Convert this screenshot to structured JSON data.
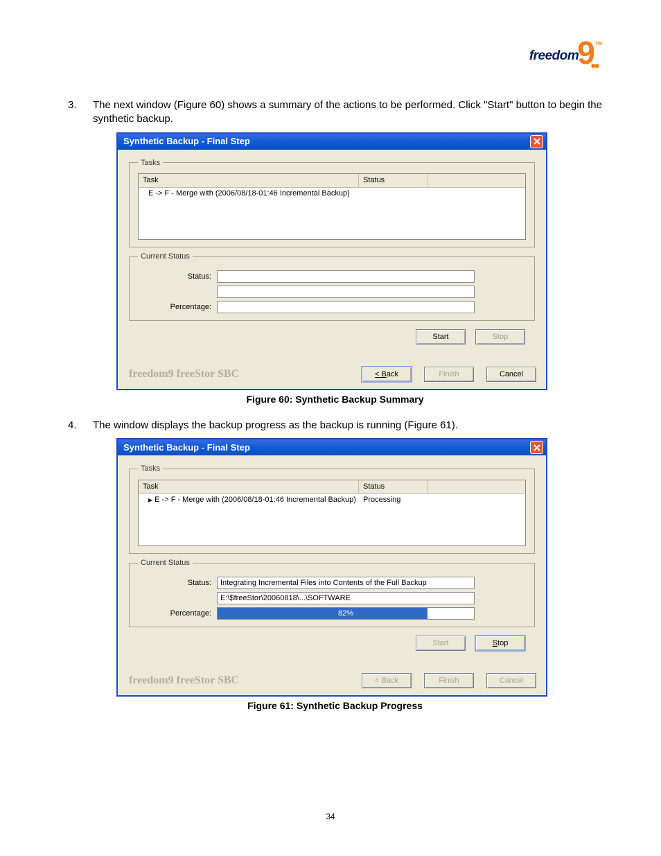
{
  "logo": {
    "word": "freedom",
    "nine": "9",
    "tm": "TM"
  },
  "step3": {
    "num": "3.",
    "text": "The next window (Figure 60) shows a summary of the actions to be performed.  Click \"Start\" button to begin the synthetic backup."
  },
  "step4": {
    "num": "4.",
    "text": "The window displays the backup progress as the backup is running (Figure 61)."
  },
  "dialog_common": {
    "title": "Synthetic Backup - Final Step",
    "tasks_legend": "Tasks",
    "current_legend": "Current Status",
    "col_task": "Task",
    "col_status": "Status",
    "status_label": "Status:",
    "percentage_label": "Percentage:",
    "start": "Start",
    "stop": "Stop",
    "back": "< Back",
    "finish": "Finish",
    "cancel": "Cancel",
    "brand": "freedom9 freeStor SBC"
  },
  "fig60": {
    "task_row": {
      "task": "E -> F - Merge with (2006/08/18-01:46 Incremental Backup)",
      "status": ""
    },
    "status_value": "",
    "status_value2": "",
    "percentage": "",
    "caption": "Figure 60: Synthetic Backup Summary"
  },
  "fig61": {
    "task_row": {
      "task": "E -> F - Merge with (2006/08/18-01:46 Incremental Backup)",
      "status": "Processing"
    },
    "status_value": "Integrating Incremental Files into Contents of the Full Backup",
    "status_value2": "E:\\$freeStor\\20060818\\...\\SOFTWARE",
    "percentage_text": "82%",
    "percentage_value": 82,
    "caption": "Figure 61: Synthetic Backup Progress"
  },
  "page_number": "34"
}
